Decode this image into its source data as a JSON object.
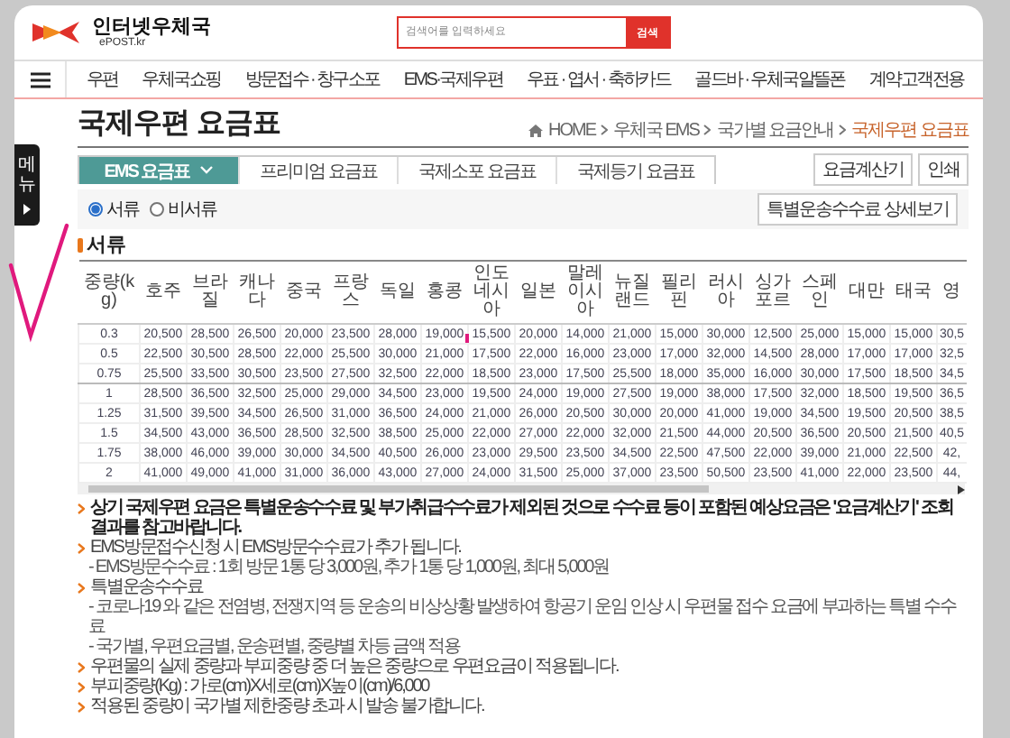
{
  "header": {
    "logo_name": "인터넷우체국",
    "logo_sub": "ePOST.kr",
    "search": {
      "placeholder": "검색어를 입력하세요",
      "button": "검색"
    }
  },
  "nav": {
    "items": [
      "우편",
      "우체국쇼핑",
      "방문접수 · 창구소포",
      "EMS·국제우편",
      "우표 · 엽서 · 축하카드",
      "골드바 · 우체국알뜰폰",
      "계약고객전용"
    ]
  },
  "side_tab": {
    "label": "메뉴"
  },
  "page": {
    "title": "국제우편 요금표",
    "breadcrumb": [
      "HOME",
      "우체국 EMS",
      "국가별 요금안내",
      "국제우편 요금표"
    ]
  },
  "tabs": [
    {
      "label": "EMS 요금표",
      "selected": true
    },
    {
      "label": "프리미엄 요금표",
      "selected": false
    },
    {
      "label": "국제소포 요금표",
      "selected": false
    },
    {
      "label": "국제등기 요금표",
      "selected": false
    }
  ],
  "actions": [
    "요금계산기",
    "인쇄"
  ],
  "mail_type": [
    {
      "label": "서류",
      "selected": true
    },
    {
      "label": "비서류",
      "selected": false
    }
  ],
  "detail_button": "특별운송수수료 상세보기",
  "section_title": "서류",
  "table": {
    "columns": [
      "중량(kg)",
      "호주",
      "브라질",
      "캐나다",
      "중국",
      "프랑스",
      "독일",
      "홍콩",
      "인도네시아",
      "일본",
      "말레이시아",
      "뉴질랜드",
      "필리핀",
      "러시아",
      "싱가포르",
      "스페인",
      "대만",
      "태국",
      "영"
    ],
    "rows": [
      [
        "0.3",
        "20,500",
        "28,500",
        "26,500",
        "20,000",
        "23,500",
        "28,000",
        "19,000",
        "15,500",
        "20,000",
        "14,000",
        "21,000",
        "15,000",
        "30,000",
        "12,500",
        "25,000",
        "15,000",
        "15,000",
        "30,5"
      ],
      [
        "0.5",
        "22,500",
        "30,500",
        "28,500",
        "22,000",
        "25,500",
        "30,000",
        "21,000",
        "17,500",
        "22,000",
        "16,000",
        "23,000",
        "17,000",
        "32,000",
        "14,500",
        "28,000",
        "17,000",
        "17,000",
        "32,5"
      ],
      [
        "0.75",
        "25,500",
        "33,500",
        "30,500",
        "23,500",
        "27,500",
        "32,500",
        "22,000",
        "18,500",
        "23,000",
        "17,500",
        "25,500",
        "18,000",
        "35,000",
        "16,000",
        "30,000",
        "17,500",
        "18,500",
        "34,5"
      ],
      [
        "1",
        "28,500",
        "36,500",
        "32,500",
        "25,000",
        "29,000",
        "34,500",
        "23,000",
        "19,500",
        "24,000",
        "19,000",
        "27,500",
        "19,000",
        "38,000",
        "17,500",
        "32,000",
        "18,500",
        "19,500",
        "36,5"
      ],
      [
        "1.25",
        "31,500",
        "39,500",
        "34,500",
        "26,500",
        "31,000",
        "36,500",
        "24,000",
        "21,000",
        "26,000",
        "20,500",
        "30,000",
        "20,000",
        "41,000",
        "19,000",
        "34,500",
        "19,500",
        "20,500",
        "38,5"
      ],
      [
        "1.5",
        "34,500",
        "43,000",
        "36,500",
        "28,500",
        "32,500",
        "38,500",
        "25,000",
        "22,000",
        "27,000",
        "22,000",
        "32,000",
        "21,500",
        "44,000",
        "20,500",
        "36,500",
        "20,500",
        "21,500",
        "40,5"
      ],
      [
        "1.75",
        "38,000",
        "46,000",
        "39,000",
        "30,000",
        "34,500",
        "40,500",
        "26,000",
        "23,000",
        "29,500",
        "23,500",
        "34,500",
        "22,500",
        "47,500",
        "22,000",
        "39,000",
        "21,000",
        "22,500",
        "42,"
      ],
      [
        "2",
        "41,000",
        "49,000",
        "41,000",
        "31,000",
        "36,000",
        "43,000",
        "27,000",
        "24,000",
        "31,500",
        "25,000",
        "37,000",
        "23,500",
        "50,500",
        "23,500",
        "41,000",
        "22,000",
        "23,500",
        "44,"
      ]
    ]
  },
  "notes": [
    {
      "kind": "strong",
      "text": "상기 국제우편 요금은 특별운송수수료 및 부가취급수수료가 제외된 것으로 수수료 등이 포함된 예상요금은 '요금계산기' 조회 결과를 참고바랍니다."
    },
    {
      "kind": "bullet",
      "text": "EMS방문접수신청 시 EMS방문수수료가 추가 됩니다."
    },
    {
      "kind": "sub",
      "text": "- EMS방문수수료 : 1회 방문 1통 당 3,000원, 추가 1통 당 1,000원, 최대 5,000원"
    },
    {
      "kind": "bullet",
      "text": "특별운송수수료"
    },
    {
      "kind": "sub",
      "text": "- 코로나19 와 같은 전염병, 전쟁지역 등 운송의 비상상황 발생하여 항공기 운임 인상 시 우편물 접수 요금에 부과하는 특별 수수료"
    },
    {
      "kind": "sub",
      "text": "- 국가별, 우편요금별, 운송편별, 중량별 차등 금액 적용"
    },
    {
      "kind": "bullet",
      "text": "우편물의 실제 중량과 부피중량 중 더 높은 중량으로 우편요금이 적용됩니다."
    },
    {
      "kind": "bullet",
      "text": "부피중량(Kg) : 가로(cm)X세로(cm)X높이(cm)/6,000"
    },
    {
      "kind": "bullet",
      "text": "적용된 중량이 국가별 제한중량 초과 시 발송 불가합니다."
    }
  ]
}
